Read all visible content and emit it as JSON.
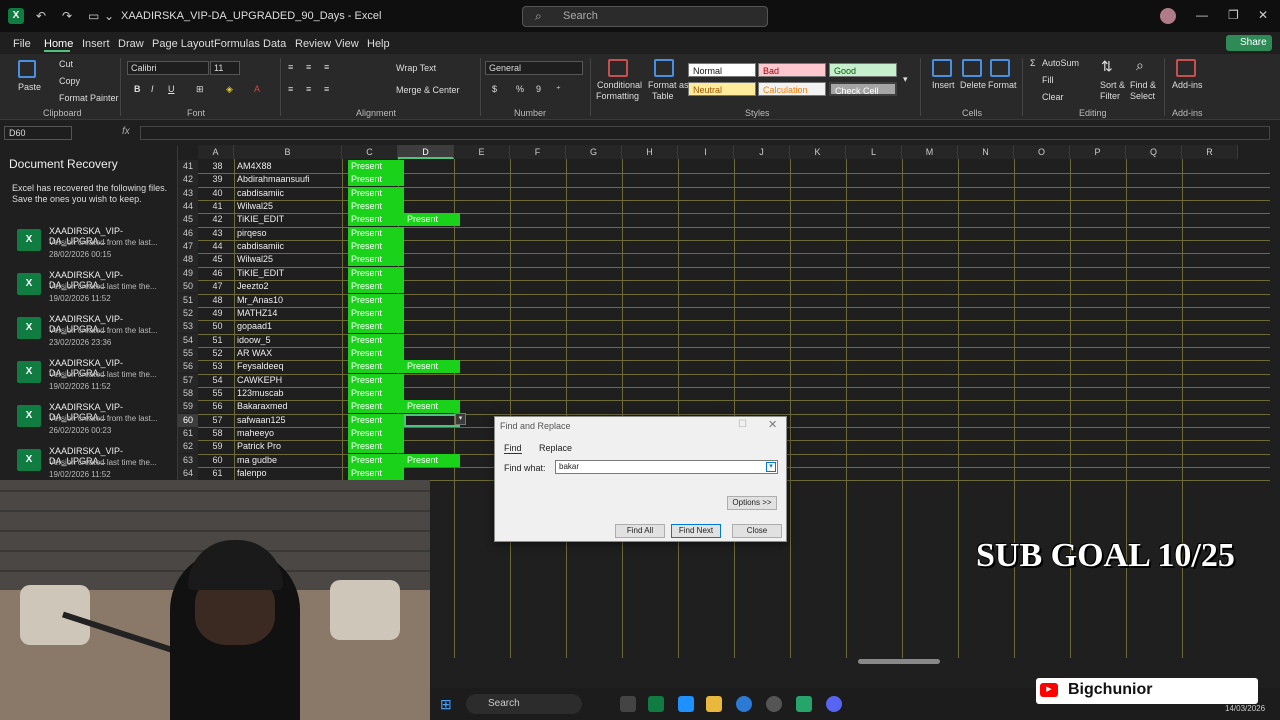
{
  "window": {
    "title": "XAADIRSKA_VIP-DA_UPGRADED_90_Days  -  Excel",
    "search_placeholder": "Search"
  },
  "menu": [
    "File",
    "Home",
    "Insert",
    "Draw",
    "Page Layout",
    "Formulas",
    "Data",
    "Review",
    "View",
    "Help"
  ],
  "share": "Share",
  "ribbon": {
    "clipboard": {
      "paste": "Paste",
      "cut": "Cut",
      "copy": "Copy",
      "painter": "Format Painter",
      "group": "Clipboard"
    },
    "font": {
      "name": "Calibri",
      "size": "11",
      "group": "Font"
    },
    "alignment": {
      "wrap": "Wrap Text",
      "merge": "Merge & Center",
      "group": "Alignment"
    },
    "number": {
      "format": "General",
      "group": "Number"
    },
    "styles": {
      "cond": "Conditional",
      "cond2": "Formatting",
      "fmt_table": "Format as",
      "fmt_table2": "Table",
      "normal": "Normal",
      "bad": "Bad",
      "good": "Good",
      "neutral": "Neutral",
      "calculation": "Calculation",
      "check": "Check Cell",
      "group": "Styles"
    },
    "cells": {
      "insert": "Insert",
      "delete": "Delete",
      "format": "Format",
      "group": "Cells"
    },
    "editing": {
      "autosum": "AutoSum",
      "fill": "Fill",
      "clear": "Clear",
      "sort": "Sort &",
      "sort2": "Filter",
      "find": "Find &",
      "find2": "Select",
      "group": "Editing"
    },
    "addins": {
      "label": "Add-ins",
      "group": "Add-ins"
    }
  },
  "namebox": "D60",
  "fx": "fx",
  "recovery": {
    "title": "Document Recovery",
    "desc": "Excel has recovered the following files.  Save the ones you wish to keep.",
    "items": [
      {
        "name": "XAADIRSKA_VIP-DA_UPGRA...",
        "sub": "Version created from the last...",
        "date": "28/02/2026 00:15"
      },
      {
        "name": "XAADIRSKA_VIP-DA_UPGRA...",
        "sub": "Version created last time the...",
        "date": "19/02/2026 11:52"
      },
      {
        "name": "XAADIRSKA_VIP-DA_UPGRA...",
        "sub": "Version created from the last...",
        "date": "23/02/2026 23:36"
      },
      {
        "name": "XAADIRSKA_VIP-DA_UPGRA...",
        "sub": "Version created last time the...",
        "date": "19/02/2026 11:52"
      },
      {
        "name": "XAADIRSKA_VIP-DA_UPGRA...",
        "sub": "Version created from the last...",
        "date": "26/02/2026 00:23"
      },
      {
        "name": "XAADIRSKA_VIP-DA_UPGRA...",
        "sub": "Version created last time the...",
        "date": "19/02/2026 11:52"
      }
    ]
  },
  "columns": [
    "A",
    "B",
    "C",
    "D",
    "E",
    "F",
    "G",
    "H",
    "I",
    "J",
    "K",
    "L",
    "M",
    "N",
    "O",
    "P",
    "Q",
    "R"
  ],
  "rows": [
    {
      "r": "41",
      "a": "38",
      "b": "AM4X88",
      "c": "Present",
      "d": ""
    },
    {
      "r": "42",
      "a": "39",
      "b": "Abdirahmaansuufi",
      "c": "Present",
      "d": ""
    },
    {
      "r": "43",
      "a": "40",
      "b": "cabdisamiic",
      "c": "Present",
      "d": ""
    },
    {
      "r": "44",
      "a": "41",
      "b": "Wilwal25",
      "c": "Present",
      "d": ""
    },
    {
      "r": "45",
      "a": "42",
      "b": "TiKIE_EDIT",
      "c": "Present",
      "d": "Present"
    },
    {
      "r": "46",
      "a": "43",
      "b": "pirqeso",
      "c": "Present",
      "d": ""
    },
    {
      "r": "47",
      "a": "44",
      "b": "cabdisamiic",
      "c": "Present",
      "d": ""
    },
    {
      "r": "48",
      "a": "45",
      "b": "Wilwal25",
      "c": "Present",
      "d": ""
    },
    {
      "r": "49",
      "a": "46",
      "b": "TiKIE_EDIT",
      "c": "Present",
      "d": ""
    },
    {
      "r": "50",
      "a": "47",
      "b": "Jeezto2",
      "c": "Present",
      "d": ""
    },
    {
      "r": "51",
      "a": "48",
      "b": "Mr_Anas10",
      "c": "Present",
      "d": ""
    },
    {
      "r": "52",
      "a": "49",
      "b": "MATHZ14",
      "c": "Present",
      "d": ""
    },
    {
      "r": "53",
      "a": "50",
      "b": "gopaad1",
      "c": "Present",
      "d": ""
    },
    {
      "r": "54",
      "a": "51",
      "b": "idoow_5",
      "c": "Present",
      "d": ""
    },
    {
      "r": "55",
      "a": "52",
      "b": "AR WAX",
      "c": "Present",
      "d": ""
    },
    {
      "r": "56",
      "a": "53",
      "b": "Feysaldeeq",
      "c": "Present",
      "d": "Present"
    },
    {
      "r": "57",
      "a": "54",
      "b": "CAWKEPH",
      "c": "Present",
      "d": ""
    },
    {
      "r": "58",
      "a": "55",
      "b": "123muscab",
      "c": "Present",
      "d": ""
    },
    {
      "r": "59",
      "a": "56",
      "b": "Bakaraxmed",
      "c": "Present",
      "d": "Present"
    },
    {
      "r": "60",
      "a": "57",
      "b": "safwaan125",
      "c": "Present",
      "d": ""
    },
    {
      "r": "61",
      "a": "58",
      "b": "maheeyo",
      "c": "Present",
      "d": ""
    },
    {
      "r": "62",
      "a": "59",
      "b": "Patrick Pro",
      "c": "Present",
      "d": ""
    },
    {
      "r": "63",
      "a": "60",
      "b": "ma gudbe",
      "c": "Present",
      "d": "Present"
    },
    {
      "r": "64",
      "a": "61",
      "b": "falenpo",
      "c": "Present",
      "d": ""
    }
  ],
  "dialog": {
    "title": "Find and Replace",
    "tab_find": "Find",
    "tab_replace": "Replace",
    "label": "Find what:",
    "value": "bakar",
    "options": "Options >>",
    "find_all": "Find All",
    "find_next": "Find Next",
    "close": "Close"
  },
  "overlay": {
    "subgoal": "SUB GOAL 10/25",
    "channel": "Bigchunior"
  },
  "taskbar": {
    "search": "Search",
    "date": "14/03/2026"
  }
}
